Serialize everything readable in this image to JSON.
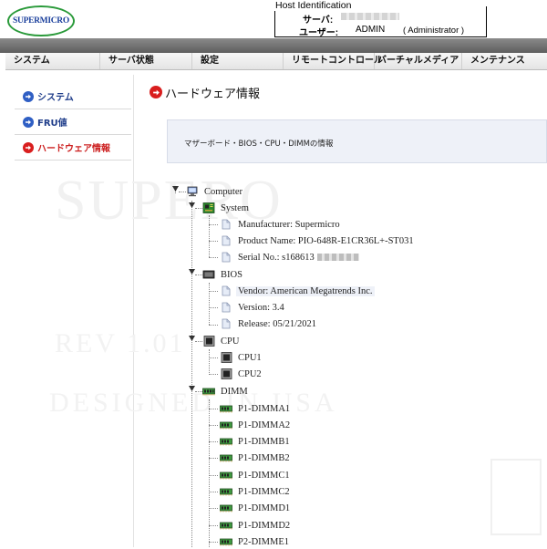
{
  "header": {
    "logo_text": "SUPERMICRO",
    "host": {
      "legend": "Host Identification",
      "server_label": "サーバ:",
      "user_label": "ユーザー:",
      "user_value": "ADMIN",
      "role": "( Administrator )"
    }
  },
  "menu": [
    "システム",
    "サーバ状態",
    "設定",
    "リモートコントロール",
    "バーチャルメディア",
    "メンテナンス"
  ],
  "sidebar": [
    {
      "label": "システム",
      "active": false
    },
    {
      "label": "FRU値",
      "active": false
    },
    {
      "label": "ハードウェア情報",
      "active": true
    }
  ],
  "page": {
    "title": "ハードウェア情報",
    "info": "マザーボード・BIOS・CPU・DIMMの情報"
  },
  "watermark": {
    "line1": "SUPERO",
    "line2": "REV 1.01",
    "line3": "DESIGNED IN USA"
  },
  "tree": {
    "root": "Computer",
    "system": {
      "label": "System",
      "items": [
        "Manufacturer: Supermicro",
        "Product Name: PIO-648R-E1CR36L+-ST031",
        "Serial No.: s168613"
      ]
    },
    "bios": {
      "label": "BIOS",
      "items": [
        "Vendor: American Megatrends Inc.",
        "Version: 3.4",
        "Release: 05/21/2021"
      ]
    },
    "cpu": {
      "label": "CPU",
      "items": [
        "CPU1",
        "CPU2"
      ]
    },
    "dimm": {
      "label": "DIMM",
      "items": [
        "P1-DIMMA1",
        "P1-DIMMA2",
        "P1-DIMMB1",
        "P1-DIMMB2",
        "P1-DIMMC1",
        "P1-DIMMC2",
        "P1-DIMMD1",
        "P1-DIMMD2",
        "P2-DIMME1"
      ]
    }
  },
  "colors": {
    "accent_red": "#d91e1e",
    "accent_blue": "#2f5fc4",
    "logo_blue": "#1a3f9c",
    "logo_green": "#2a9a3a",
    "panel_bg": "#eef1f8"
  }
}
